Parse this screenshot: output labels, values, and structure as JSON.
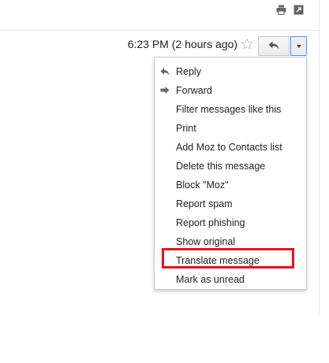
{
  "toolbar": {
    "icons": [
      "print-icon",
      "new-window-icon"
    ]
  },
  "message_header": {
    "timestamp": "6:23 PM (2 hours ago)",
    "star_icon": "star-outline-icon",
    "reply_icon": "reply-icon",
    "more_icon": "chevron-down-icon"
  },
  "menu": {
    "items": [
      {
        "label": "Reply",
        "icon": "reply-icon"
      },
      {
        "label": "Forward",
        "icon": "forward-icon"
      },
      {
        "label": "Filter messages like this"
      },
      {
        "label": "Print"
      },
      {
        "label": "Add Moz to Contacts list"
      },
      {
        "label": "Delete this message"
      },
      {
        "label": "Block \"Moz\""
      },
      {
        "label": "Report spam"
      },
      {
        "label": "Report phishing"
      },
      {
        "label": "Show original"
      },
      {
        "label": "Translate message",
        "highlighted": true
      },
      {
        "label": "Mark as unread"
      }
    ]
  },
  "colors": {
    "highlight_border": "#e8111b",
    "dropdown_focus_border": "#4d90fe",
    "text": "#222222"
  }
}
